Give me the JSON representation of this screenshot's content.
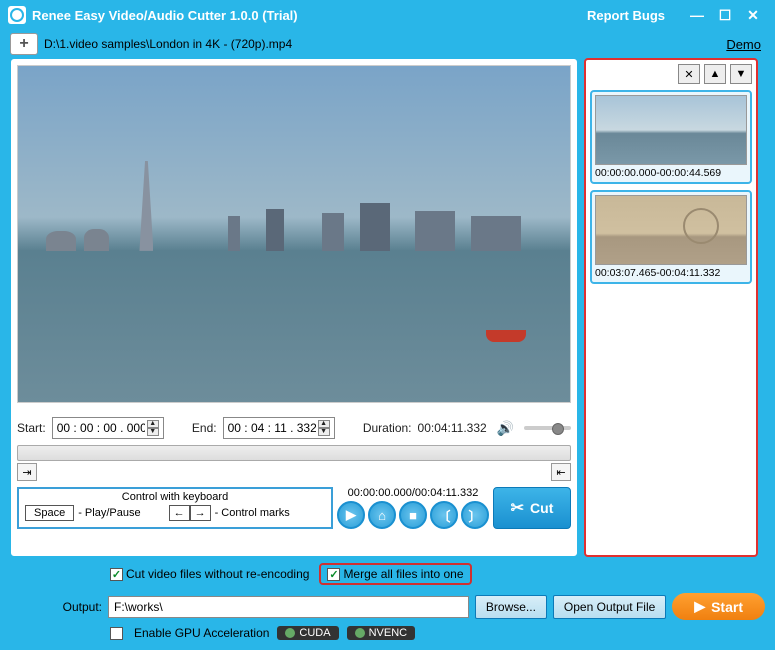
{
  "titlebar": {
    "app_title": "Renee Easy Video/Audio Cutter 1.0.0 (Trial)",
    "report_bugs": "Report Bugs"
  },
  "pathbar": {
    "file_path": "D:\\1.video samples\\London in 4K - (720p).mp4",
    "demo": "Demo"
  },
  "time": {
    "start_label": "Start:",
    "start_value": "00 : 00 : 00 . 000",
    "end_label": "End:",
    "end_value": "00 : 04 : 11 . 332",
    "duration_label": "Duration:",
    "duration_value": "00:04:11.332"
  },
  "keyboard": {
    "title": "Control with keyboard",
    "space_key": "Space",
    "space_desc": "- Play/Pause",
    "arrows_desc": "- Control marks"
  },
  "playback": {
    "range_text": "00:00:00.000/00:04:11.332",
    "cut_label": "Cut"
  },
  "clips": [
    {
      "time": "00:00:00.000-00:00:44.569"
    },
    {
      "time": "00:03:07.465-00:04:11.332"
    }
  ],
  "options": {
    "cut_no_reencode": "Cut video files without re-encoding",
    "merge_all": "Merge all files into one"
  },
  "output": {
    "label": "Output:",
    "path": "F:\\works\\",
    "browse": "Browse...",
    "open": "Open Output File",
    "start": "Start"
  },
  "gpu": {
    "enable": "Enable GPU Acceleration",
    "cuda": "CUDA",
    "nvenc": "NVENC"
  }
}
